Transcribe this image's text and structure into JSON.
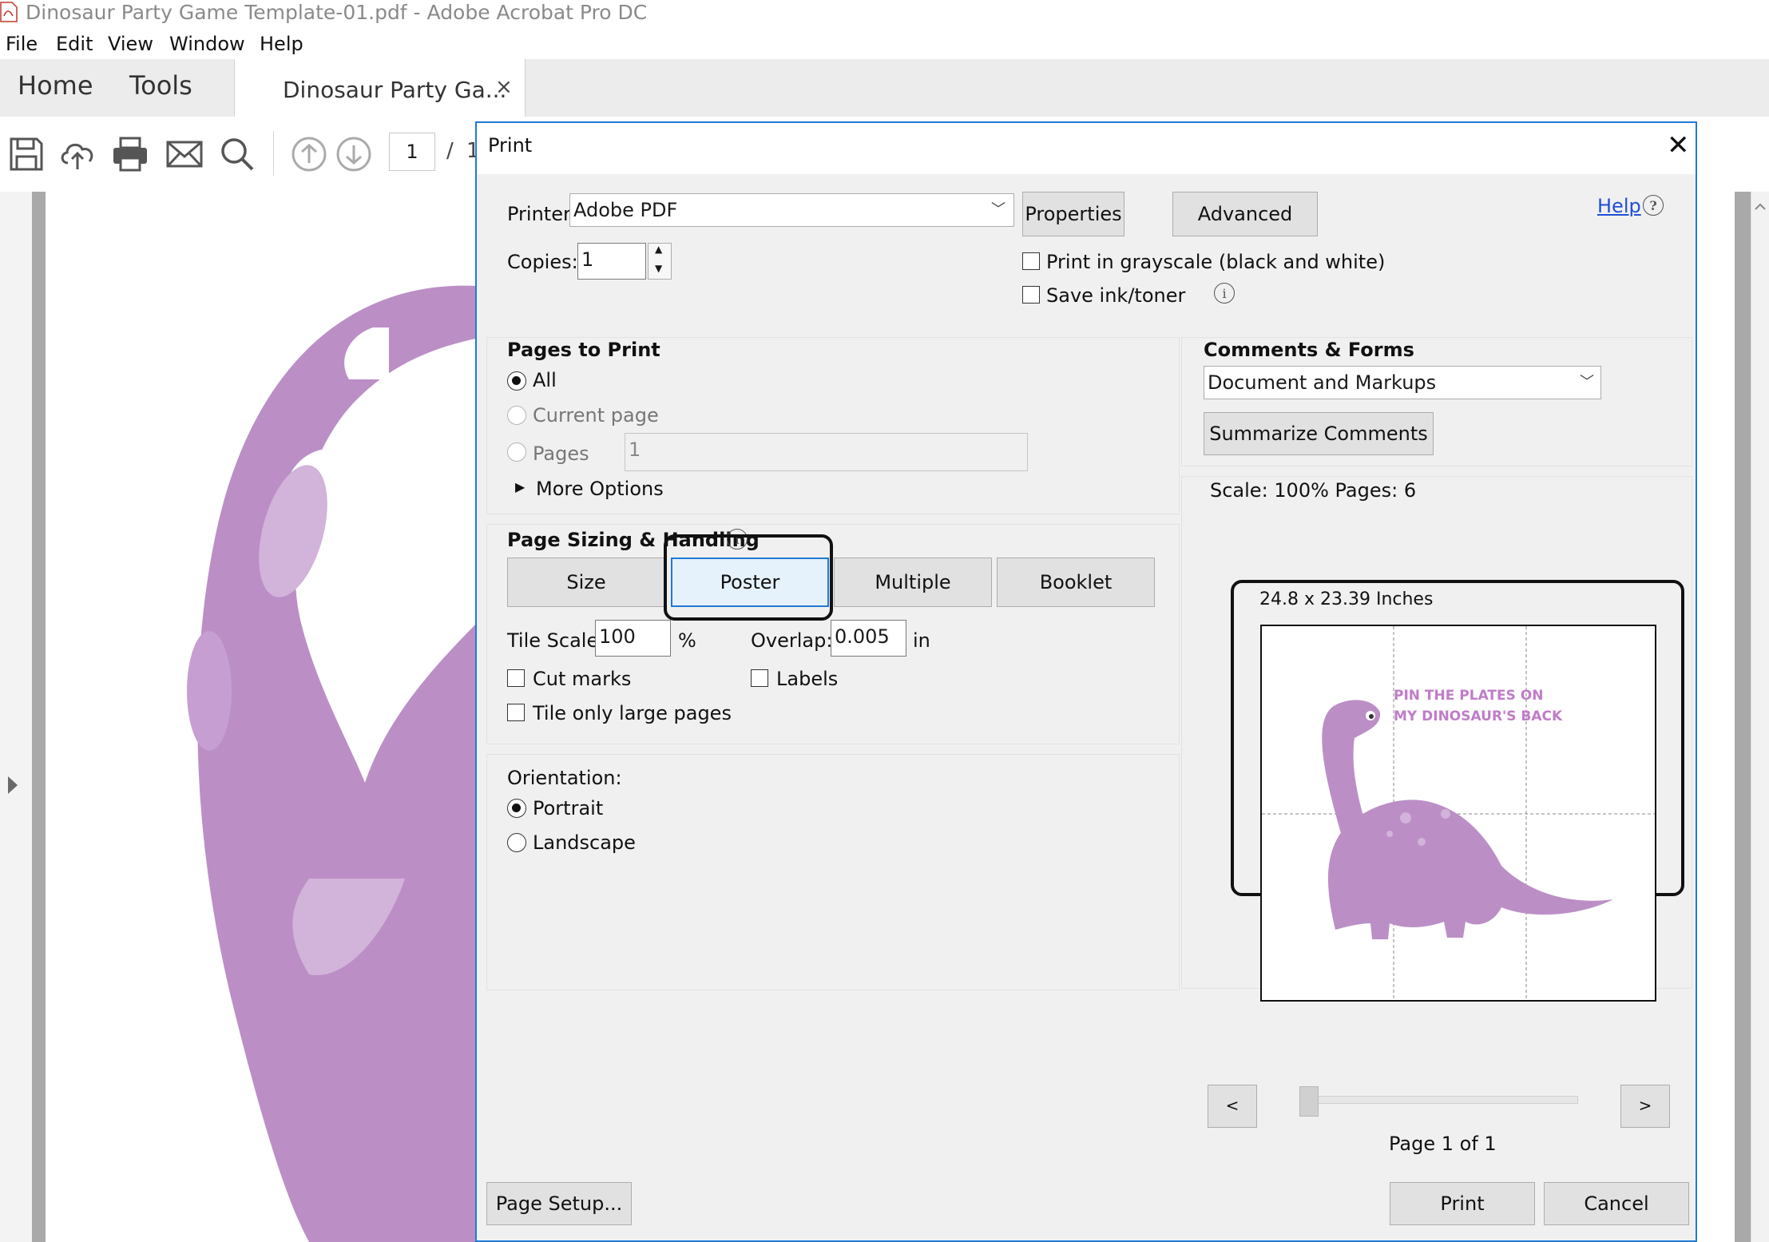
{
  "window": {
    "title": "Dinosaur Party Game Template-01.pdf - Adobe Acrobat Pro DC"
  },
  "menu": [
    "File",
    "Edit",
    "View",
    "Window",
    "Help"
  ],
  "tabs": {
    "home": "Home",
    "tools": "Tools",
    "document": "Dinosaur Party Ga...",
    "close": "×"
  },
  "toolbar": {
    "page_current": "1",
    "page_sep": "/",
    "page_total": "1"
  },
  "dialog": {
    "title": "Print",
    "close": "✕",
    "printer_label": "Printer:",
    "printer_value": "Adobe PDF",
    "properties_button": "Properties",
    "advanced_button": "Advanced",
    "help_link": "Help",
    "copies_label": "Copies:",
    "copies_value": "1",
    "grayscale_label": "Print in grayscale (black and white)",
    "save_ink_label": "Save ink/toner",
    "pages_to_print": {
      "heading": "Pages to Print",
      "all": "All",
      "current_page": "Current page",
      "pages": "Pages",
      "pages_value": "1",
      "more_options": "More Options"
    },
    "page_sizing": {
      "heading": "Page Sizing & Handling",
      "size": "Size",
      "poster": "Poster",
      "multiple": "Multiple",
      "booklet": "Booklet",
      "tile_scale_label": "Tile Scale:",
      "tile_scale_value": "100",
      "percent": "%",
      "overlap_label": "Overlap:",
      "overlap_value": "0.005",
      "overlap_unit": "in",
      "cut_marks": "Cut marks",
      "labels": "Labels",
      "tile_only_large": "Tile only large pages"
    },
    "orientation": {
      "heading": "Orientation:",
      "portrait": "Portrait",
      "landscape": "Landscape"
    },
    "comments_forms": {
      "heading": "Comments & Forms",
      "value": "Document and Markups",
      "summarize_button": "Summarize Comments"
    },
    "preview": {
      "scale_pages": "Scale: 100% Pages: 6",
      "dimensions": "24.8 x 23.39 Inches",
      "artwork_text_line1": "PIN THE PLATES ON",
      "artwork_text_line2": "MY DINOSAUR'S BACK",
      "prev": "<",
      "next": ">",
      "page_indicator": "Page 1 of 1"
    },
    "page_setup_button": "Page Setup...",
    "print_button": "Print",
    "cancel_button": "Cancel"
  },
  "colors": {
    "dino": "#bb8fc6",
    "dino_light": "#d2b3d9",
    "accent": "#1f7ad4",
    "artwork_text": "#c07cc8"
  }
}
